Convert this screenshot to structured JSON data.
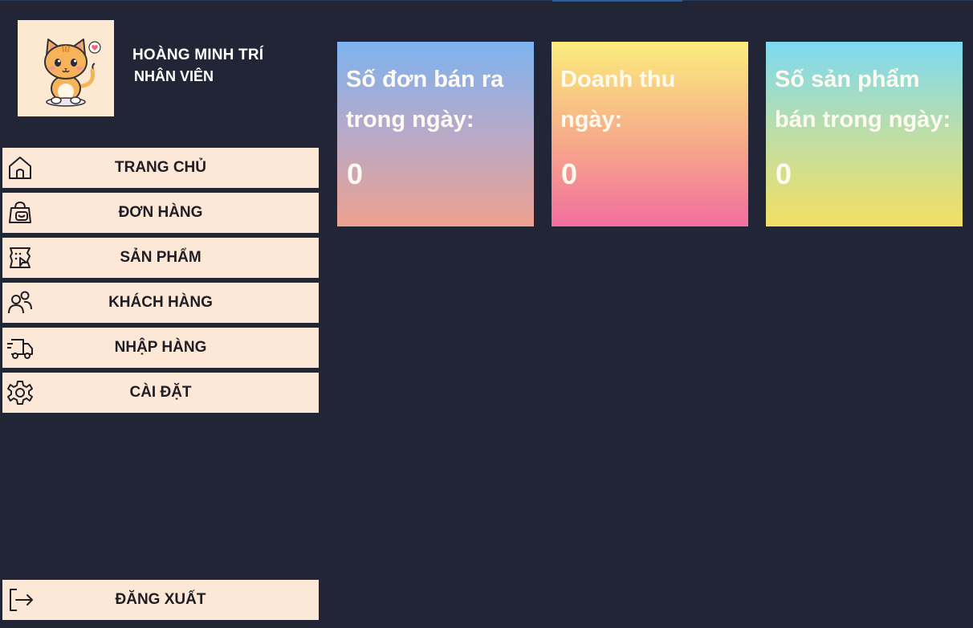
{
  "user": {
    "name": "HOÀNG MINH TRÍ",
    "role": "NHÂN VIÊN"
  },
  "nav": {
    "items": [
      {
        "label": "TRANG CHỦ",
        "icon": "home-icon"
      },
      {
        "label": "ĐƠN HÀNG",
        "icon": "shopping-bag-icon"
      },
      {
        "label": "SẢN PHẨM",
        "icon": "product-icon"
      },
      {
        "label": "KHÁCH HÀNG",
        "icon": "users-icon"
      },
      {
        "label": "NHẬP HÀNG",
        "icon": "truck-icon"
      },
      {
        "label": "CÀI ĐẶT",
        "icon": "gear-icon"
      }
    ],
    "logout": {
      "label": "ĐĂNG XUẤT",
      "icon": "logout-icon"
    }
  },
  "stats": [
    {
      "title": "Số đơn bán ra trong ngày:",
      "value": "0"
    },
    {
      "title": "Doanh thu ngày:",
      "value": "0"
    },
    {
      "title": "Số sản phẩm bán trong ngày:",
      "value": "0"
    }
  ],
  "colors": {
    "background": "#222535",
    "nav_button": "#fde8d8",
    "card_text": "#fffaf0"
  }
}
